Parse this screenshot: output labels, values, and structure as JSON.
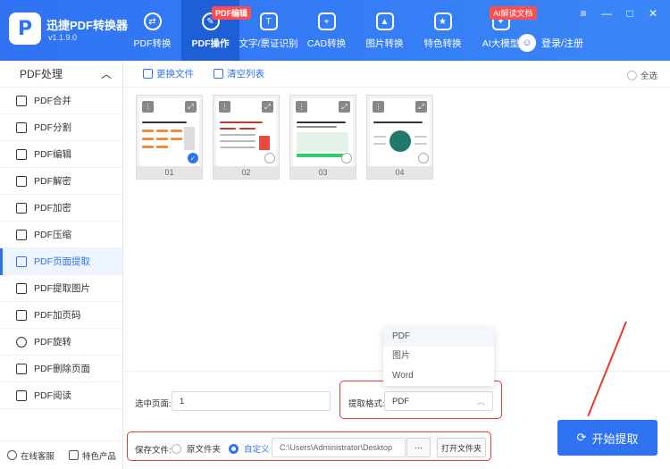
{
  "app": {
    "title": "迅捷PDF转换器",
    "version": "v1.1.9.0",
    "logo_letter": "P"
  },
  "nav": [
    {
      "label": "PDF转换",
      "icon": "convert-icon",
      "badge": ""
    },
    {
      "label": "PDF操作",
      "icon": "pdf-ops-icon",
      "badge": "PDF编辑",
      "active": true
    },
    {
      "label": "文字/票证识别",
      "icon": "ocr-icon",
      "badge": ""
    },
    {
      "label": "CAD转换",
      "icon": "cad-icon",
      "badge": ""
    },
    {
      "label": "图片转换",
      "icon": "image-icon",
      "badge": ""
    },
    {
      "label": "特色转换",
      "icon": "star-icon",
      "badge": ""
    },
    {
      "label": "AI大模型",
      "icon": "ai-icon",
      "badge": "AI解读文档"
    }
  ],
  "user": {
    "label": "登录/注册"
  },
  "window_controls": {
    "menu": "≡",
    "minimize": "—",
    "maximize": "□",
    "close": "✕"
  },
  "sidebar": {
    "heading": "PDF处理",
    "items": [
      {
        "label": "PDF合并"
      },
      {
        "label": "PDF分割"
      },
      {
        "label": "PDF编辑"
      },
      {
        "label": "PDF解密"
      },
      {
        "label": "PDF加密"
      },
      {
        "label": "PDF压缩"
      },
      {
        "label": "PDF页面提取",
        "active": true
      },
      {
        "label": "PDF提取图片"
      },
      {
        "label": "PDF加页码"
      },
      {
        "label": "PDF旋转"
      },
      {
        "label": "PDF删除页面"
      },
      {
        "label": "PDF阅读"
      }
    ],
    "footer": {
      "support": "在线客服",
      "featured": "特色产品"
    }
  },
  "toolbar": {
    "replace_file": "更换文件",
    "clear_list": "清空列表",
    "select_all": "全选"
  },
  "thumbnails": [
    {
      "number": "01",
      "checked": true
    },
    {
      "number": "02",
      "checked": false
    },
    {
      "number": "03",
      "checked": false
    },
    {
      "number": "04",
      "checked": false
    }
  ],
  "form": {
    "selected_pages_label": "选中页面:",
    "selected_pages_value": "1",
    "format_label": "提取格式:",
    "format_value": "PDF",
    "format_options": [
      "PDF",
      "图片",
      "Word"
    ],
    "save_label": "保存文件:",
    "save_original": "原文件夹",
    "save_custom": "自定义",
    "save_path": "C:\\Users\\Administrator\\Desktop",
    "browse": "···",
    "open_folder": "打开文件夹"
  },
  "start_button": {
    "label": "开始提取"
  },
  "colors": {
    "primary": "#2f73f3",
    "highlight": "#e53935"
  }
}
